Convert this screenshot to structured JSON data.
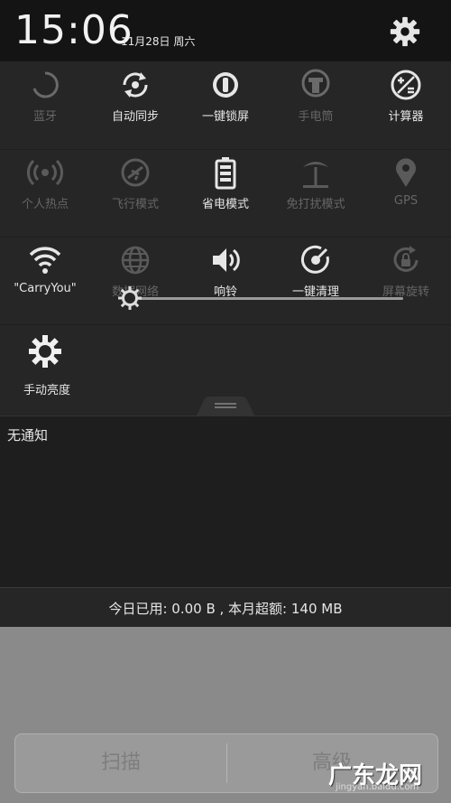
{
  "status": {
    "time": "15:06",
    "date": "11月28日 周六"
  },
  "rows": [
    [
      {
        "label": "蓝牙",
        "icon": "bluetooth-loading-icon",
        "active": false
      },
      {
        "label": "自动同步",
        "icon": "sync-icon",
        "active": true
      },
      {
        "label": "一键锁屏",
        "icon": "lock-screen-icon",
        "active": true
      },
      {
        "label": "手电筒",
        "icon": "flashlight-icon",
        "active": false
      },
      {
        "label": "计算器",
        "icon": "calculator-icon",
        "active": true
      }
    ],
    [
      {
        "label": "个人热点",
        "icon": "hotspot-icon",
        "active": false
      },
      {
        "label": "飞行模式",
        "icon": "airplane-icon",
        "active": false
      },
      {
        "label": "省电模式",
        "icon": "battery-icon",
        "active": true
      },
      {
        "label": "免打扰模式",
        "icon": "do-not-disturb-icon",
        "active": false
      },
      {
        "label": "GPS",
        "icon": "gps-icon",
        "active": false
      }
    ],
    [
      {
        "label": "\"CarryYou\"",
        "icon": "wifi-icon",
        "active": true
      },
      {
        "label": "数据网络",
        "icon": "globe-icon",
        "active": false
      },
      {
        "label": "响铃",
        "icon": "speaker-icon",
        "active": true
      },
      {
        "label": "一键清理",
        "icon": "cleanup-icon",
        "active": true
      },
      {
        "label": "屏幕旋转",
        "icon": "rotation-lock-icon",
        "active": false
      }
    ]
  ],
  "brightness": {
    "label": "手动亮度",
    "level": 0.02
  },
  "notifications": {
    "empty_label": "无通知"
  },
  "data_usage": {
    "text": "今日已用: 0.00 B , 本月超额: 140 MB"
  },
  "buttons": {
    "scan": "扫描",
    "advanced": "高级"
  },
  "watermark": {
    "main": "广东龙网",
    "sub": "jingyan.baidu.com"
  }
}
